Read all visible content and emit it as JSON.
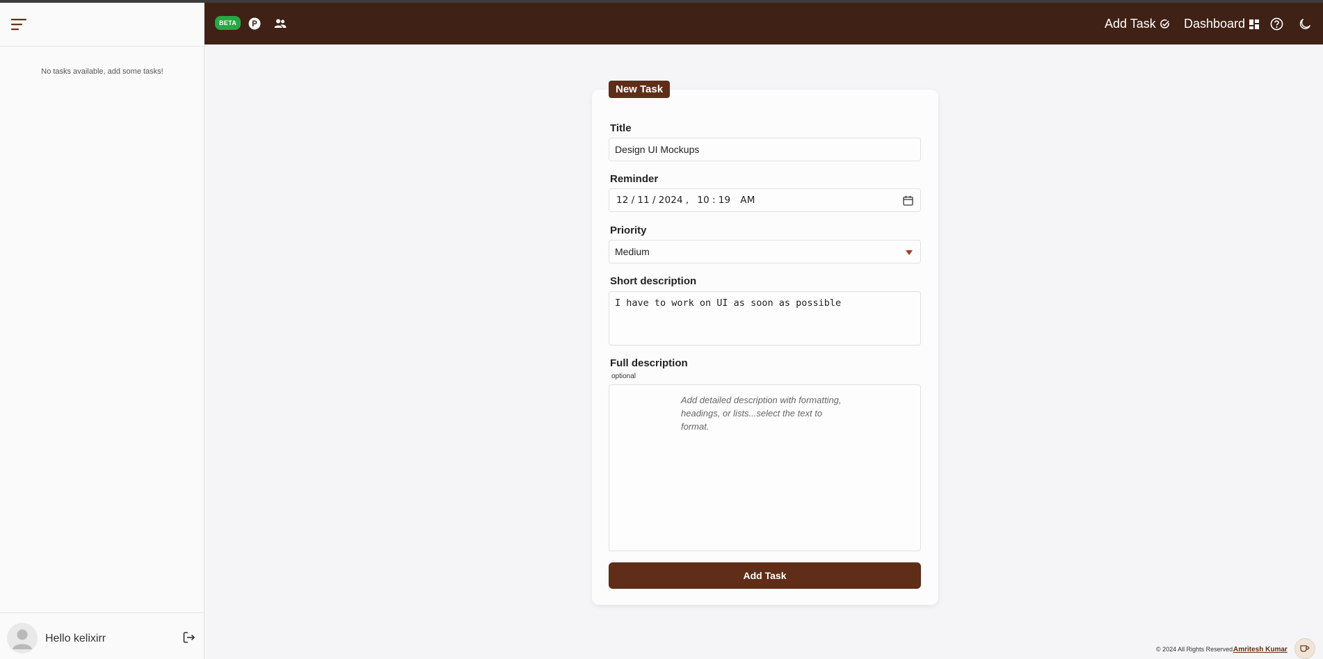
{
  "sidebar": {
    "empty_message": "No tasks available, add some tasks!",
    "greeting": "Hello kelixirr"
  },
  "header": {
    "beta_label": "BETA",
    "nav_add_task": "Add Task",
    "nav_dashboard": "Dashboard"
  },
  "form": {
    "badge": "New Task",
    "title_label": "Title",
    "title_value": "Design UI Mockups",
    "reminder_label": "Reminder",
    "reminder": {
      "month": "12",
      "day": "11",
      "year": "2024",
      "hour": "10",
      "minute": "19",
      "ampm": "AM"
    },
    "priority_label": "Priority",
    "priority_value": "Medium",
    "short_desc_label": "Short description",
    "short_desc_value": "I have to work on UI as soon as possible",
    "full_desc_label": "Full description",
    "full_desc_optional": "optional",
    "full_desc_placeholder": "Add detailed description with formatting, headings, or lists...select the text to format.",
    "submit_label": "Add Task"
  },
  "footer": {
    "copyright": "© 2024 All Rights Reserved.",
    "author": "Amritesh Kumar"
  },
  "colors": {
    "header_bg": "#3f2115",
    "accent": "#5f2d18",
    "beta_green": "#27a844",
    "caret": "#a0401c"
  }
}
